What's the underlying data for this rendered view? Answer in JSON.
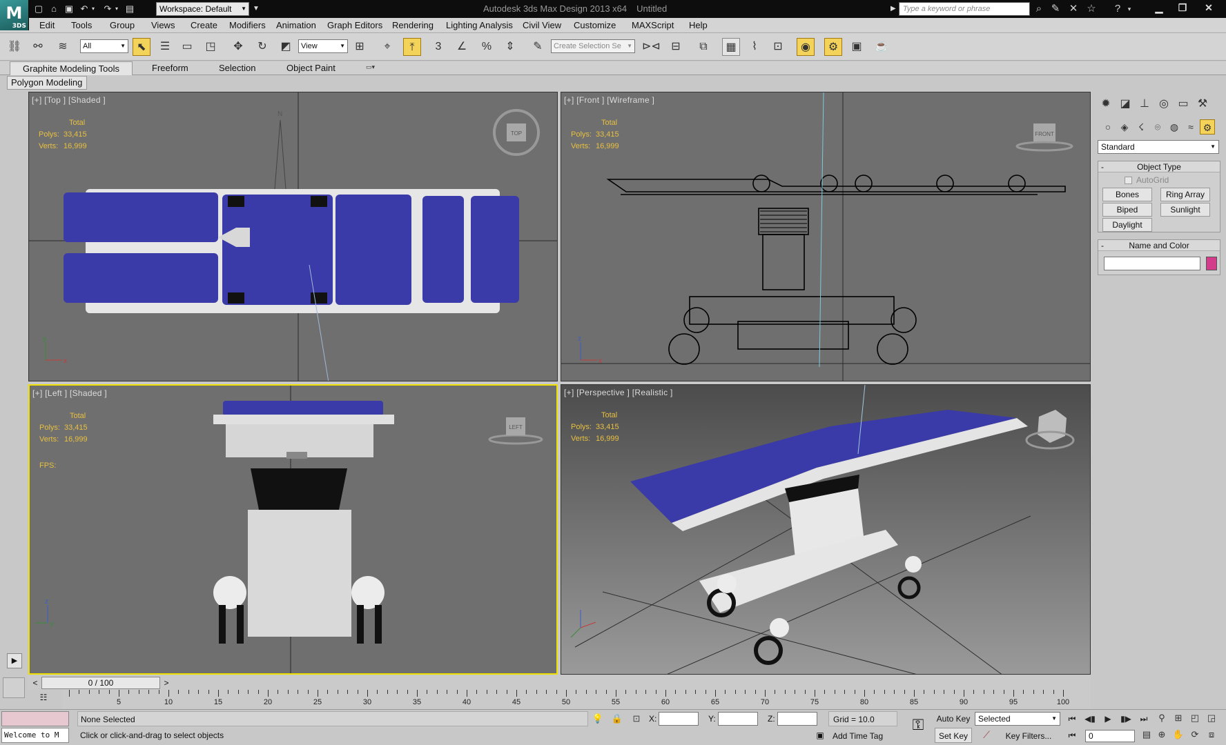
{
  "app": {
    "title": "Autodesk 3ds Max Design 2013 x64",
    "document": "Untitled",
    "workspace": "Workspace: Default",
    "search_placeholder": "Type a keyword or phrase",
    "logo_text": "3DS"
  },
  "menu": [
    "Edit",
    "Tools",
    "Group",
    "Views",
    "Create",
    "Modifiers",
    "Animation",
    "Graph Editors",
    "Rendering",
    "Lighting Analysis",
    "Civil View",
    "Customize",
    "MAXScript",
    "Help"
  ],
  "toolbar": {
    "filter": "All",
    "ref_coord": "View",
    "named_selection_placeholder": "Create Selection Se"
  },
  "ribbon": {
    "tabs": [
      "Graphite Modeling Tools",
      "Freeform",
      "Selection",
      "Object Paint"
    ],
    "active_panel": "Polygon Modeling"
  },
  "stats": {
    "total_label": "Total",
    "polys_label": "Polys:",
    "polys": "33,415",
    "verts_label": "Verts:",
    "verts": "16,999",
    "fps_label": "FPS:"
  },
  "viewports": {
    "top": {
      "label": "[+] [Top ] [Shaded ]",
      "cube": "TOP"
    },
    "front": {
      "label": "[+] [Front ] [Wireframe ]",
      "cube": "FRONT"
    },
    "left": {
      "label": "[+] [Left ] [Shaded ]",
      "cube": "LEFT"
    },
    "perspective": {
      "label": "[+] [Perspective ] [Realistic ]"
    }
  },
  "command_panel": {
    "category": "Standard",
    "object_type_title": "Object Type",
    "autogrid": "AutoGrid",
    "buttons": [
      "Bones",
      "Ring Array",
      "Biped",
      "Sunlight",
      "Daylight"
    ],
    "name_color_title": "Name and Color",
    "object_color": "#d23c8a"
  },
  "timeline": {
    "frame_display": "0 / 100",
    "ticks": [
      "5",
      "10",
      "15",
      "20",
      "25",
      "30",
      "35",
      "40",
      "45",
      "50",
      "55",
      "60",
      "65",
      "70",
      "75",
      "80",
      "85",
      "90",
      "95",
      "100"
    ]
  },
  "status": {
    "listener": "Welcome to M",
    "selection": "None Selected",
    "prompt": "Click or click-and-drag to select objects",
    "x_label": "X:",
    "y_label": "Y:",
    "z_label": "Z:",
    "grid": "Grid = 10.0",
    "add_time_tag": "Add Time Tag",
    "auto_key": "Auto Key",
    "set_key": "Set Key",
    "selected_set": "Selected",
    "key_filters": "Key Filters...",
    "current_frame": "0"
  },
  "colors": {
    "viewport_bg": "#6f6f6f",
    "active_viewport": "#f0e000",
    "stats_text": "#e8c040",
    "table_pad": "#3a3aa8",
    "table_frame": "#e6e6e6"
  }
}
